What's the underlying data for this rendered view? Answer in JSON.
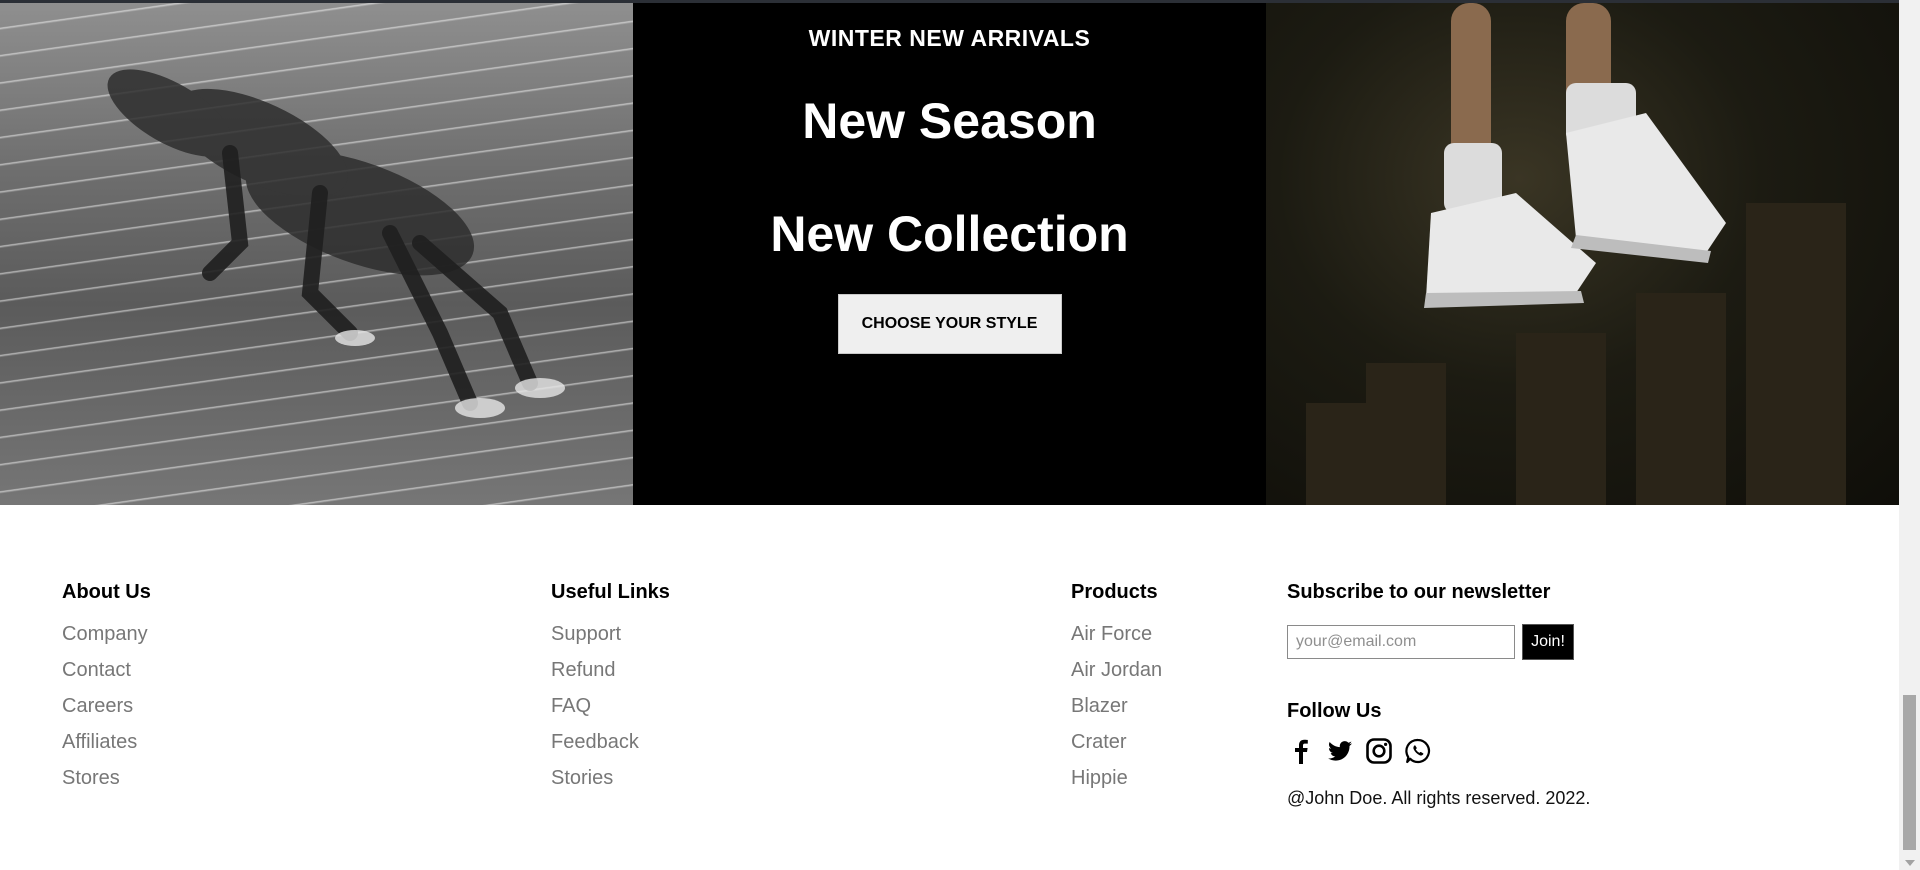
{
  "hero": {
    "eyebrow": "WINTER NEW ARRIVALS",
    "headline_line1": "New Season",
    "headline_line2": "New Collection",
    "cta_label": "CHOOSE YOUR STYLE"
  },
  "footer": {
    "about": {
      "title": "About Us",
      "items": [
        "Company",
        "Contact",
        "Careers",
        "Affiliates",
        "Stores"
      ]
    },
    "links": {
      "title": "Useful Links",
      "items": [
        "Support",
        "Refund",
        "FAQ",
        "Feedback",
        "Stories"
      ]
    },
    "products": {
      "title": "Products",
      "items": [
        "Air Force",
        "Air Jordan",
        "Blazer",
        "Crater",
        "Hippie"
      ]
    },
    "newsletter": {
      "title": "Subscribe to our newsletter",
      "email_placeholder": "your@email.com",
      "email_value": "",
      "join_label": "Join!"
    },
    "follow": {
      "title": "Follow Us",
      "icons": [
        "facebook-icon",
        "twitter-icon",
        "instagram-icon",
        "whatsapp-icon"
      ]
    },
    "copyright": "@John Doe. All rights reserved. 2022."
  },
  "colors": {
    "hero_middle_bg": "#000000",
    "link_gray": "#777777",
    "join_bg": "#000000",
    "cta_bg": "#efefef"
  }
}
